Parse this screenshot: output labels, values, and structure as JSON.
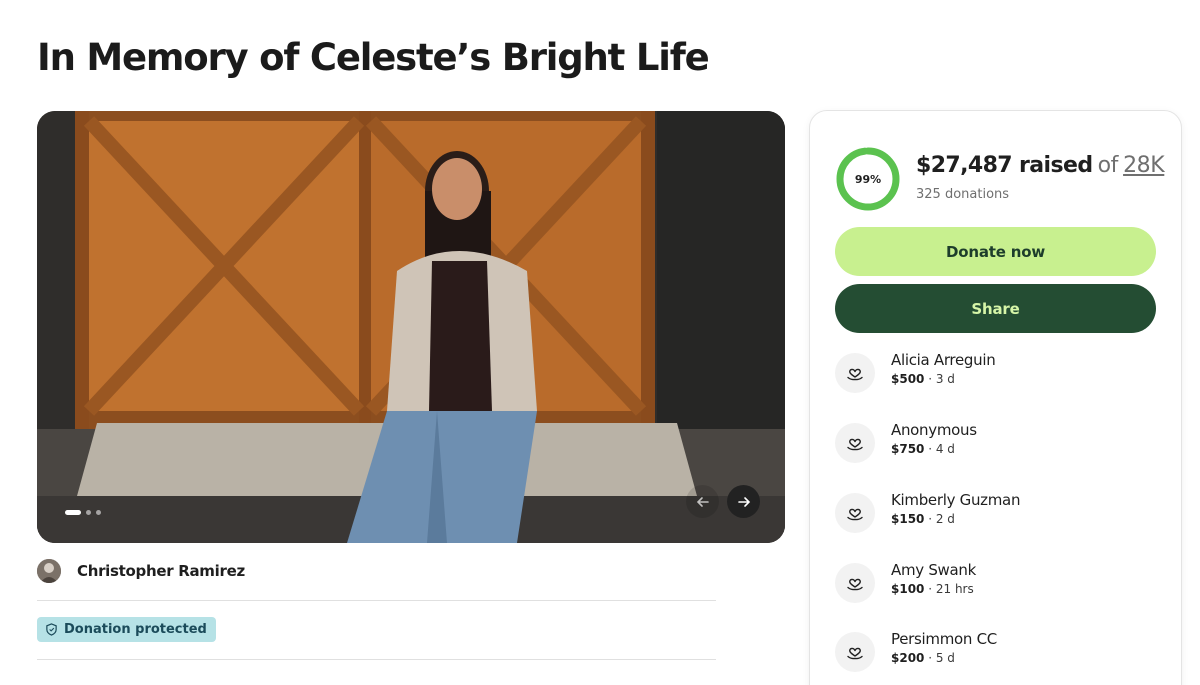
{
  "page": {
    "title": "In Memory of Celeste’s Bright Life"
  },
  "gallery": {
    "slides": 3,
    "active_slide": 1
  },
  "organizer": {
    "name": "Christopher Ramirez"
  },
  "badge": {
    "label": "Donation protected"
  },
  "progress": {
    "percent_label": "99%",
    "fraction": 0.98,
    "raised": "$27,487 raised",
    "of": "of",
    "goal": "28K",
    "donations": "325 donations",
    "ring_color": "#5bc24f"
  },
  "actions": {
    "donate": "Donate now",
    "share": "Share"
  },
  "donors": [
    {
      "name": "Alicia Arreguin",
      "amount": "$500",
      "time": "3 d"
    },
    {
      "name": "Anonymous",
      "amount": "$750",
      "time": "4 d"
    },
    {
      "name": "Kimberly Guzman",
      "amount": "$150",
      "time": "2 d"
    },
    {
      "name": "Amy Swank",
      "amount": "$100",
      "time": "21 hrs"
    },
    {
      "name": "Persimmon CC",
      "amount": "$200",
      "time": "5 d"
    }
  ],
  "colors": {
    "donate_bg": "#c8f08f",
    "share_bg": "#244d33",
    "badge_bg": "#b6e2e6"
  }
}
